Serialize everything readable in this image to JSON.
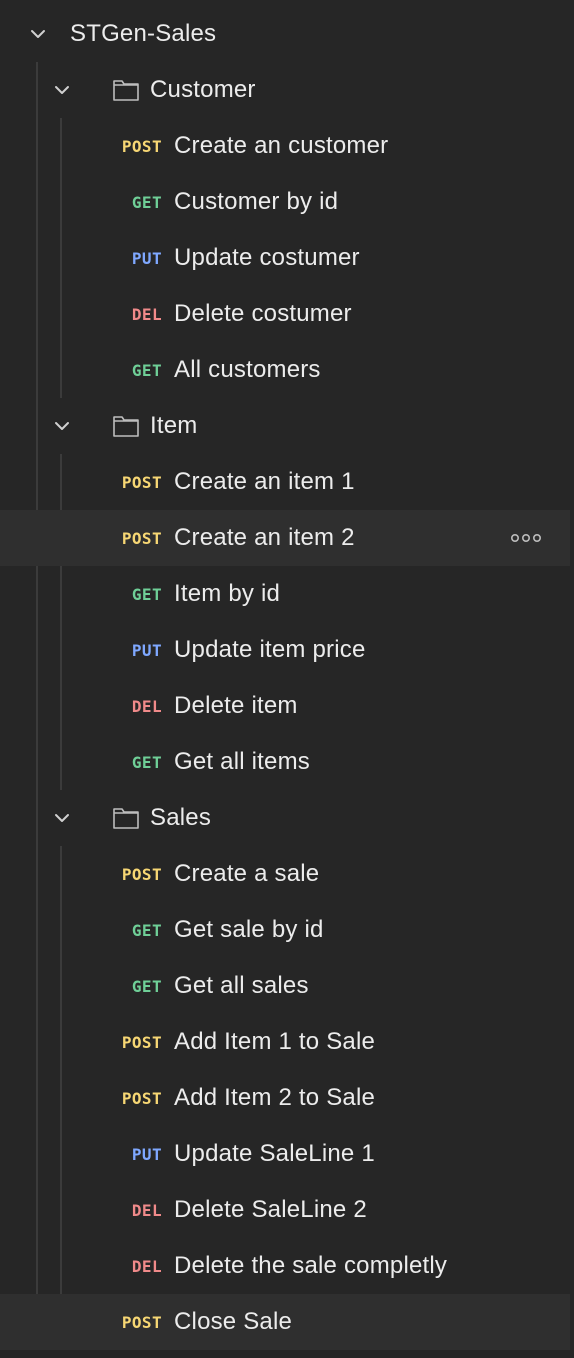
{
  "collection": {
    "name": "STGen-Sales"
  },
  "folders": [
    {
      "name": "Customer",
      "requests": [
        {
          "method": "POST",
          "name": "Create an customer"
        },
        {
          "method": "GET",
          "name": "Customer by id"
        },
        {
          "method": "PUT",
          "name": "Update costumer"
        },
        {
          "method": "DEL",
          "name": "Delete costumer"
        },
        {
          "method": "GET",
          "name": "All customers"
        }
      ]
    },
    {
      "name": "Item",
      "requests": [
        {
          "method": "POST",
          "name": "Create an item 1"
        },
        {
          "method": "POST",
          "name": "Create an item 2"
        },
        {
          "method": "GET",
          "name": "Item by id"
        },
        {
          "method": "PUT",
          "name": "Update item price"
        },
        {
          "method": "DEL",
          "name": "Delete item"
        },
        {
          "method": "GET",
          "name": "Get all items"
        }
      ]
    },
    {
      "name": "Sales",
      "requests": [
        {
          "method": "POST",
          "name": "Create a sale"
        },
        {
          "method": "GET",
          "name": "Get sale by id"
        },
        {
          "method": "GET",
          "name": "Get all sales"
        },
        {
          "method": "POST",
          "name": "Add Item 1 to Sale"
        },
        {
          "method": "POST",
          "name": "Add Item 2 to Sale"
        },
        {
          "method": "PUT",
          "name": "Update SaleLine 1"
        },
        {
          "method": "DEL",
          "name": "Delete SaleLine 2"
        },
        {
          "method": "DEL",
          "name": "Delete the sale completly"
        },
        {
          "method": "POST",
          "name": "Close Sale"
        }
      ]
    }
  ],
  "colors": {
    "background": "#262626",
    "hover": "#2f2f2f",
    "post": "#f7d774",
    "get": "#6fcf97",
    "put": "#7fa8ff",
    "del": "#f08a8a"
  }
}
